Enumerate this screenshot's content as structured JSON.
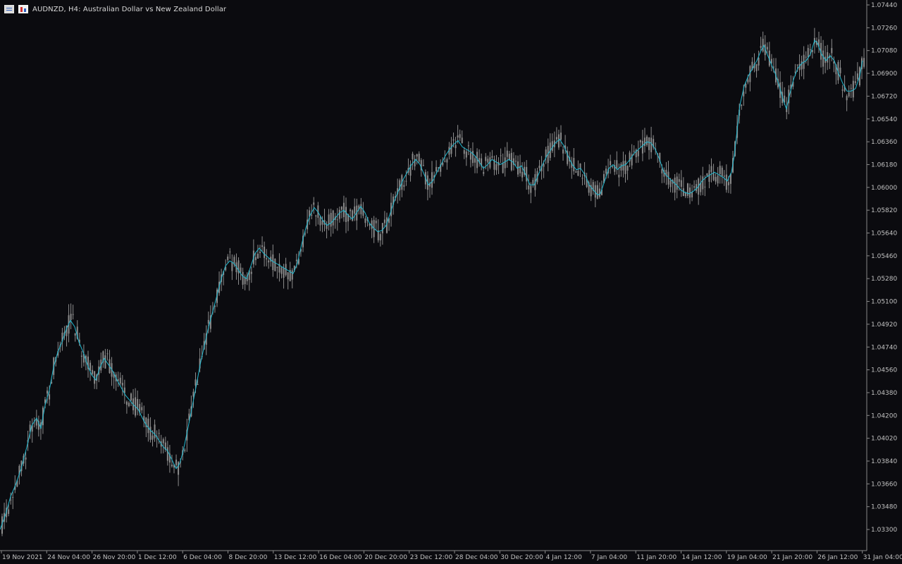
{
  "header": {
    "symbol_timeframe": "AUDNZD, H4:",
    "description": "Australian Dollar vs New Zealand Dollar",
    "title": "AUDNZD, H4:  Australian Dollar vs New Zealand Dollar"
  },
  "icons": [
    "grid-icon",
    "chart-icon"
  ],
  "colors": {
    "background": "#0b0b0f",
    "axis": "#8a8a8a",
    "candle": "#8c8c8c",
    "moving_average": "#1fb8cf",
    "text": "#c0c0c0"
  },
  "chart_data": {
    "type": "candlestick",
    "symbol": "AUDNZD",
    "timeframe": "H4",
    "y_ticks": [
      "1.07440",
      "1.07260",
      "1.07080",
      "1.06900",
      "1.06720",
      "1.06540",
      "1.06360",
      "1.06180",
      "1.06000",
      "1.05820",
      "1.05640",
      "1.05460",
      "1.05280",
      "1.05100",
      "1.04920",
      "1.04740",
      "1.04560",
      "1.04380",
      "1.04200",
      "1.04020",
      "1.03840",
      "1.03660",
      "1.03480",
      "1.03300"
    ],
    "ylim": [
      1.0321,
      1.0749
    ],
    "x_ticks": [
      "19 Nov 2021",
      "24 Nov 04:00",
      "26 Nov 20:00",
      "1 Dec 12:00",
      "6 Dec 04:00",
      "8 Dec 20:00",
      "13 Dec 12:00",
      "16 Dec 04:00",
      "20 Dec 20:00",
      "23 Dec 12:00",
      "28 Dec 04:00",
      "30 Dec 20:00",
      "4 Jan 12:00",
      "7 Jan 04:00",
      "11 Jan 20:00",
      "14 Jan 12:00",
      "19 Jan 04:00",
      "21 Jan 20:00",
      "26 Jan 12:00",
      "31 Jan 04:00"
    ],
    "close_path": [
      [
        0,
        1.033
      ],
      [
        8,
        1.0342
      ],
      [
        15,
        1.0356
      ],
      [
        22,
        1.0365
      ],
      [
        30,
        1.0378
      ],
      [
        38,
        1.0395
      ],
      [
        45,
        1.0412
      ],
      [
        52,
        1.0418
      ],
      [
        58,
        1.041
      ],
      [
        64,
        1.0428
      ],
      [
        70,
        1.044
      ],
      [
        76,
        1.0458
      ],
      [
        82,
        1.047
      ],
      [
        88,
        1.0478
      ],
      [
        94,
        1.0488
      ],
      [
        100,
        1.0495
      ],
      [
        106,
        1.049
      ],
      [
        112,
        1.0478
      ],
      [
        118,
        1.047
      ],
      [
        124,
        1.046
      ],
      [
        130,
        1.0452
      ],
      [
        136,
        1.0448
      ],
      [
        142,
        1.0458
      ],
      [
        148,
        1.0465
      ],
      [
        154,
        1.046
      ],
      [
        160,
        1.0455
      ],
      [
        166,
        1.0448
      ],
      [
        172,
        1.0442
      ],
      [
        178,
        1.0436
      ],
      [
        184,
        1.0432
      ],
      [
        190,
        1.0428
      ],
      [
        196,
        1.0425
      ],
      [
        202,
        1.0418
      ],
      [
        208,
        1.0412
      ],
      [
        214,
        1.0408
      ],
      [
        220,
        1.0405
      ],
      [
        226,
        1.04
      ],
      [
        232,
        1.0395
      ],
      [
        238,
        1.0392
      ],
      [
        244,
        1.0385
      ],
      [
        250,
        1.0378
      ],
      [
        255,
        1.0382
      ],
      [
        260,
        1.0392
      ],
      [
        266,
        1.0408
      ],
      [
        272,
        1.0425
      ],
      [
        278,
        1.0442
      ],
      [
        284,
        1.046
      ],
      [
        290,
        1.0475
      ],
      [
        296,
        1.049
      ],
      [
        302,
        1.0502
      ],
      [
        308,
        1.0515
      ],
      [
        314,
        1.0528
      ],
      [
        320,
        1.0538
      ],
      [
        326,
        1.0542
      ],
      [
        332,
        1.054
      ],
      [
        338,
        1.0535
      ],
      [
        344,
        1.053
      ],
      [
        350,
        1.0528
      ],
      [
        356,
        1.0538
      ],
      [
        362,
        1.0548
      ],
      [
        368,
        1.0552
      ],
      [
        374,
        1.0548
      ],
      [
        380,
        1.0545
      ],
      [
        386,
        1.0542
      ],
      [
        392,
        1.054
      ],
      [
        398,
        1.0538
      ],
      [
        404,
        1.0536
      ],
      [
        410,
        1.0534
      ],
      [
        416,
        1.0532
      ],
      [
        422,
        1.054
      ],
      [
        428,
        1.0555
      ],
      [
        434,
        1.0568
      ],
      [
        440,
        1.0578
      ],
      [
        446,
        1.0584
      ],
      [
        452,
        1.058
      ],
      [
        458,
        1.0574
      ],
      [
        464,
        1.057
      ],
      [
        470,
        1.0572
      ],
      [
        476,
        1.0576
      ],
      [
        482,
        1.058
      ],
      [
        488,
        1.0582
      ],
      [
        494,
        1.0578
      ],
      [
        500,
        1.0575
      ],
      [
        506,
        1.058
      ],
      [
        512,
        1.0585
      ],
      [
        518,
        1.058
      ],
      [
        524,
        1.0572
      ],
      [
        530,
        1.0568
      ],
      [
        536,
        1.0565
      ],
      [
        542,
        1.0566
      ],
      [
        548,
        1.057
      ],
      [
        554,
        1.058
      ],
      [
        560,
        1.059
      ],
      [
        566,
        1.0598
      ],
      [
        572,
        1.0606
      ],
      [
        578,
        1.0612
      ],
      [
        584,
        1.0618
      ],
      [
        590,
        1.0622
      ],
      [
        596,
        1.0618
      ],
      [
        602,
        1.061
      ],
      [
        608,
        1.0602
      ],
      [
        614,
        1.0605
      ],
      [
        620,
        1.0612
      ],
      [
        626,
        1.0618
      ],
      [
        632,
        1.0625
      ],
      [
        638,
        1.063
      ],
      [
        644,
        1.0634
      ],
      [
        650,
        1.0637
      ],
      [
        656,
        1.0632
      ],
      [
        662,
        1.063
      ],
      [
        668,
        1.0628
      ],
      [
        674,
        1.0625
      ],
      [
        680,
        1.062
      ],
      [
        686,
        1.0615
      ],
      [
        692,
        1.0618
      ],
      [
        698,
        1.0622
      ],
      [
        704,
        1.062
      ],
      [
        710,
        1.0618
      ],
      [
        716,
        1.062
      ],
      [
        722,
        1.0622
      ],
      [
        728,
        1.062
      ],
      [
        734,
        1.0615
      ],
      [
        740,
        1.0617
      ],
      [
        746,
        1.061
      ],
      [
        752,
        1.0602
      ],
      [
        758,
        1.0602
      ],
      [
        764,
        1.061
      ],
      [
        770,
        1.0618
      ],
      [
        776,
        1.0625
      ],
      [
        782,
        1.063
      ],
      [
        788,
        1.0635
      ],
      [
        794,
        1.0638
      ],
      [
        800,
        1.0633
      ],
      [
        806,
        1.0625
      ],
      [
        812,
        1.0618
      ],
      [
        818,
        1.0614
      ],
      [
        824,
        1.0615
      ],
      [
        830,
        1.061
      ],
      [
        836,
        1.0602
      ],
      [
        842,
        1.0598
      ],
      [
        848,
        1.0594
      ],
      [
        852,
        1.0595
      ],
      [
        858,
        1.0605
      ],
      [
        864,
        1.0615
      ],
      [
        870,
        1.0618
      ],
      [
        876,
        1.0614
      ],
      [
        882,
        1.0617
      ],
      [
        888,
        1.0618
      ],
      [
        894,
        1.0622
      ],
      [
        900,
        1.0627
      ],
      [
        906,
        1.063
      ],
      [
        912,
        1.0633
      ],
      [
        918,
        1.0636
      ],
      [
        924,
        1.0635
      ],
      [
        930,
        1.063
      ],
      [
        936,
        1.0622
      ],
      [
        942,
        1.0612
      ],
      [
        948,
        1.0608
      ],
      [
        954,
        1.0605
      ],
      [
        960,
        1.0602
      ],
      [
        966,
        1.0598
      ],
      [
        972,
        1.0596
      ],
      [
        978,
        1.0595
      ],
      [
        984,
        1.0597
      ],
      [
        990,
        1.06
      ],
      [
        996,
        1.0605
      ],
      [
        1002,
        1.0608
      ],
      [
        1008,
        1.061
      ],
      [
        1014,
        1.0612
      ],
      [
        1020,
        1.061
      ],
      [
        1026,
        1.0608
      ],
      [
        1032,
        1.0605
      ],
      [
        1038,
        1.0612
      ],
      [
        1042,
        1.0625
      ],
      [
        1046,
        1.0645
      ],
      [
        1050,
        1.0665
      ],
      [
        1056,
        1.068
      ],
      [
        1062,
        1.0688
      ],
      [
        1068,
        1.0694
      ],
      [
        1074,
        1.07
      ],
      [
        1080,
        1.0708
      ],
      [
        1084,
        1.0712
      ],
      [
        1088,
        1.0706
      ],
      [
        1094,
        1.0698
      ],
      [
        1100,
        1.069
      ],
      [
        1106,
        1.068
      ],
      [
        1112,
        1.0668
      ],
      [
        1116,
        1.0662
      ],
      [
        1120,
        1.0672
      ],
      [
        1126,
        1.0685
      ],
      [
        1132,
        1.0694
      ],
      [
        1138,
        1.0698
      ],
      [
        1144,
        1.07
      ],
      [
        1150,
        1.0705
      ],
      [
        1156,
        1.0716
      ],
      [
        1160,
        1.0714
      ],
      [
        1166,
        1.0705
      ],
      [
        1172,
        1.07
      ],
      [
        1178,
        1.0704
      ],
      [
        1184,
        1.07
      ],
      [
        1190,
        1.069
      ],
      [
        1196,
        1.0682
      ],
      [
        1202,
        1.0676
      ],
      [
        1208,
        1.0676
      ],
      [
        1214,
        1.0678
      ],
      [
        1220,
        1.0688
      ],
      [
        1224,
        1.07
      ]
    ]
  }
}
